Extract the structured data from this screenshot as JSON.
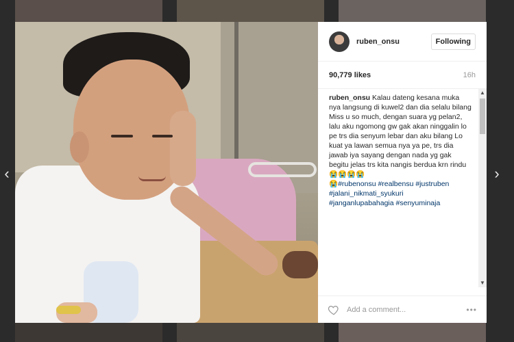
{
  "post": {
    "username": "ruben_onsu",
    "follow_label": "Following",
    "likes": "90,779 likes",
    "time": "16h"
  },
  "caption": {
    "user": "ruben_onsu",
    "text": " Kalau dateng kesana muka nya langsung di kuwel2 dan dia selalu bilang Miss u so much, dengan suara yg pelan2, lalu aku ngomong gw gak akan ninggalin lo pe trs dia senyum lebar dan aku bilang Lo kuat ya lawan semua nya ya pe, trs dia jawab iya sayang dengan nada yg gak begitu jelas trs kita nangis berdua krn rindu ",
    "emojis_line1": "😭😭😭😭",
    "emoji_line2": "😭",
    "hashtags_line1": "#rubenonsu #realbensu #justruben",
    "hashtags_line2": "#jalani_nikmati_syukuri",
    "hashtags_line3": "#janganlupabahagia #senyuminaja"
  },
  "comment": {
    "placeholder": "Add a comment..."
  },
  "icons": {
    "prev": "chevron-left-icon",
    "next": "chevron-right-icon",
    "like": "heart-icon",
    "more": "more-options-icon"
  },
  "nav": {
    "prev_glyph": "‹",
    "next_glyph": "›",
    "more_glyph": "•••",
    "scroll_up_glyph": "▲",
    "scroll_down_glyph": "▼"
  },
  "colors": {
    "hashtag": "#003569",
    "overlay": "#2b2b2b"
  }
}
